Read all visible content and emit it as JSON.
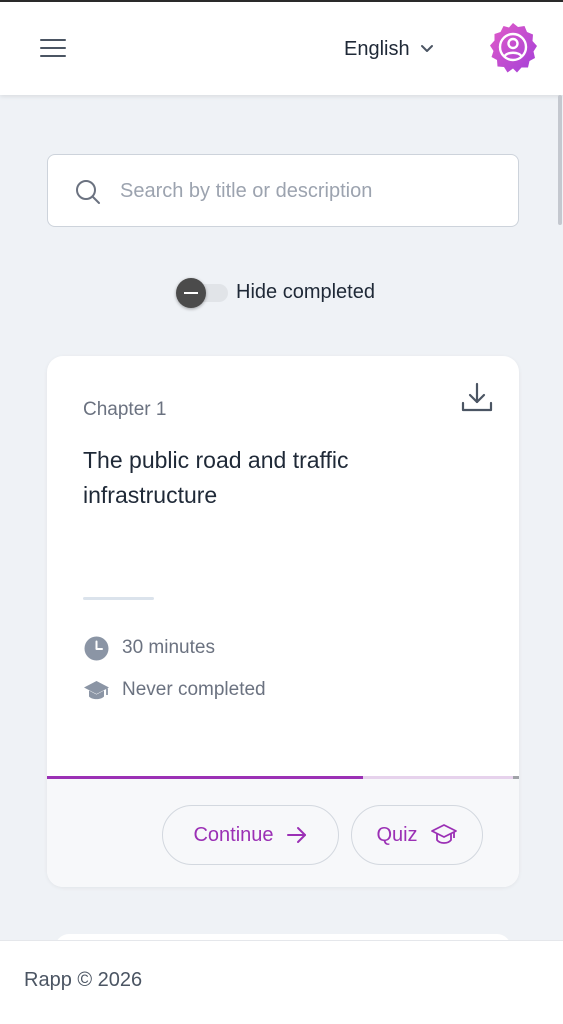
{
  "header": {
    "language": "English"
  },
  "search": {
    "placeholder": "Search by title or description",
    "value": ""
  },
  "filter": {
    "label": "Hide completed",
    "enabled": false
  },
  "card": {
    "chapter": "Chapter 1",
    "title": "The public road and traffic infrastructure",
    "duration": "30 minutes",
    "completion": "Never completed",
    "progress": 0.67,
    "continue_label": "Continue",
    "quiz_label": "Quiz"
  },
  "footer": {
    "text": "Rapp © 2026"
  },
  "colors": {
    "accent": "#9b30b5",
    "avatar_gradient_start": "#e25bc8",
    "avatar_gradient_end": "#a340d8",
    "background": "#eff2f6"
  },
  "icons": {
    "menu": "hamburger-icon",
    "language_caret": "chevron-down-icon",
    "avatar": "user-badge-icon",
    "search": "search-icon",
    "download": "download-icon",
    "duration": "clock-icon",
    "completion": "graduation-cap-icon",
    "continue": "arrow-right-icon",
    "quiz": "graduation-cap-icon"
  }
}
